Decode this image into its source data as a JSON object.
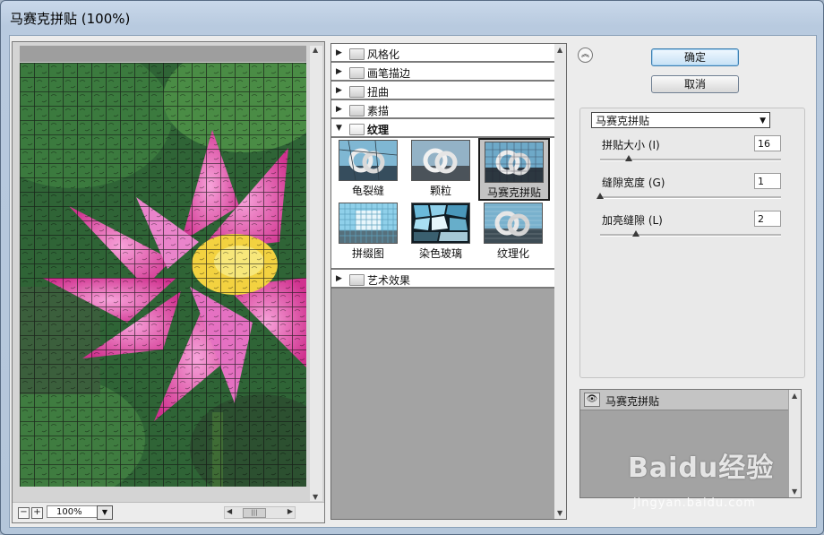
{
  "window": {
    "title": "马赛克拼贴 (100%)"
  },
  "preview": {
    "zoom_value": "100%",
    "zoom_minus": "−",
    "zoom_plus": "+"
  },
  "gallery": {
    "categories_before": [
      {
        "label": "风格化"
      },
      {
        "label": "画笔描边"
      },
      {
        "label": "扭曲"
      },
      {
        "label": "素描"
      }
    ],
    "open_category": {
      "label": "纹理"
    },
    "filters": [
      {
        "label": "龟裂缝",
        "selected": false
      },
      {
        "label": "颗粒",
        "selected": false
      },
      {
        "label": "马赛克拼贴",
        "selected": true
      },
      {
        "label": "拼缀图",
        "selected": false
      },
      {
        "label": "染色玻璃",
        "selected": false
      },
      {
        "label": "纹理化",
        "selected": false
      }
    ],
    "categories_after": [
      {
        "label": "艺术效果"
      }
    ]
  },
  "buttons": {
    "ok": "确定",
    "cancel": "取消"
  },
  "settings": {
    "filter_select": "马赛克拼贴",
    "params": [
      {
        "label": "拼贴大小 (I)",
        "value": "16",
        "level": 0.16
      },
      {
        "label": "缝隙宽度 (G)",
        "value": "1",
        "level": 0.0
      },
      {
        "label": "加亮缝隙 (L)",
        "value": "2",
        "level": 0.2
      }
    ]
  },
  "layers": {
    "items": [
      {
        "name": "马赛克拼贴"
      }
    ]
  },
  "watermark": {
    "brand": "Baidu经验",
    "url": "jingyan.baidu.com"
  },
  "colors": {
    "accent": "#3c7fb1",
    "title_bar": "#c9d8ea",
    "panel": "#ececec"
  }
}
